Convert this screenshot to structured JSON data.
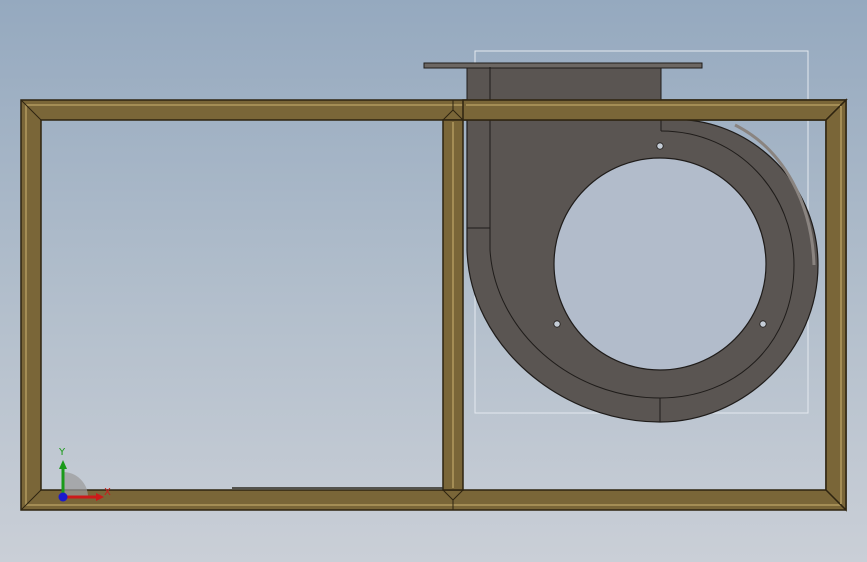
{
  "viewport": {
    "background_top": "#95a9bf",
    "background_bottom": "#cacfd7"
  },
  "model": {
    "frame_color": "#7a6638",
    "frame_edge_color": "#2e2410",
    "housing_color": "#5a5552",
    "housing_edge_color": "#1f1c1a",
    "selection_box_color": "#dfe5ec",
    "icons": [
      "rectangular-frame",
      "blower-housing",
      "flange-plate",
      "mounting-hole"
    ]
  },
  "triad": {
    "x_label": "X",
    "y_label": "Y",
    "x_color": "#cc1a1a",
    "y_color": "#1a9a1a",
    "z_color": "#1a1acc"
  }
}
